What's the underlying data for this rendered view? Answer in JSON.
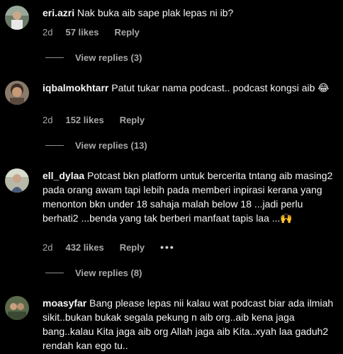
{
  "comments": [
    {
      "username": "eri.azri",
      "text": "Nak buka aib sape plak lepas ni ib?",
      "time": "2d",
      "likes": "57 likes",
      "reply": "Reply",
      "view_replies": "View replies (3)"
    },
    {
      "username": "iqbalmokhtarr",
      "text": "Patut tukar nama podcast.. podcast kongsi aib 😂",
      "time": "2d",
      "likes": "152 likes",
      "reply": "Reply",
      "view_replies": "View replies (13)"
    },
    {
      "username": "ell_dylaa",
      "text": "Potcast bkn platform untuk bercerita tntang aib masing2 pada orang awam tapi lebih pada memberi inpirasi kerana yang menonton bkn under 18 sahaja malah below 18 ...jadi perlu berhati2 ...benda yang tak berberi manfaat tapis laa ...🙌",
      "time": "2d",
      "likes": "432 likes",
      "reply": "Reply",
      "more": "•••",
      "view_replies": "View replies (8)"
    },
    {
      "username": "moasyfar",
      "text": "Bang please lepas nii kalau wat podcast biar ada ilmiah sikit..bukan bukak segala pekung n aib org..aib kena jaga bang..kalau Kita jaga aib org Allah jaga aib Kita..xyah laa gaduh2 rendah kan ego tu.."
    }
  ],
  "colors": {
    "background": "#000000",
    "text": "#f5f5f5",
    "secondary": "#a8a8a8"
  }
}
